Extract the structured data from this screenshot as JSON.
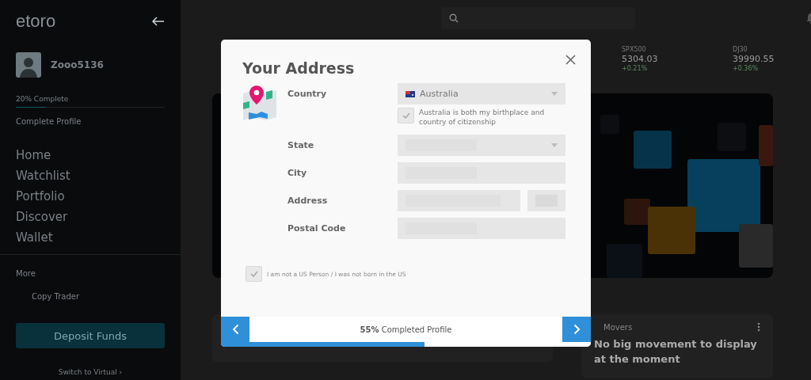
{
  "sidebar": {
    "logo": "etoro",
    "username": "Zooo5136",
    "profile_progress": {
      "label": "20% Complete",
      "level": 0.2
    },
    "complete_profile": "Complete Profile",
    "nav": [
      "Home",
      "Watchlist",
      "Portfolio",
      "Discover",
      "Wallet"
    ],
    "more": "More",
    "more_items": [
      "Copy Trader"
    ],
    "deposit_button": "Deposit Funds",
    "switch_link": "Switch to Virtual ›"
  },
  "tickers": [
    {
      "symbol": "SPX500",
      "price": "5304.03",
      "change": "+0.21%"
    },
    {
      "symbol": "DJ30",
      "price": "39990.55",
      "change": "+0.36%"
    }
  ],
  "big_movers": {
    "title": "Movers",
    "message": "No big movement to display at the moment"
  },
  "modal": {
    "title": "Your Address",
    "fields": [
      {
        "label": "Country",
        "kind": "select",
        "value": "Australia"
      },
      {
        "label": "State",
        "kind": "select"
      },
      {
        "label": "City",
        "kind": "text"
      },
      {
        "label": "Address",
        "kind": "split"
      },
      {
        "label": "Postal Code",
        "kind": "text"
      }
    ],
    "birthplace_checkbox": {
      "label": "Australia is both my birthplace and country of citizenship",
      "checked": true
    },
    "us_checkbox": {
      "label": "I am not a US Person / I was not born in the US",
      "checked": true
    },
    "footer": {
      "text": "**55%** Completed Profile",
      "level": 0.55
    }
  }
}
